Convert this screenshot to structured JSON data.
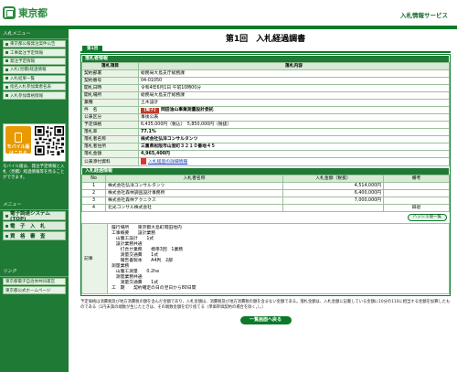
{
  "header": {
    "logo_text": "東京都",
    "service_name": "入札情報サービス"
  },
  "sidebar": {
    "menu_title": "入札メニュー",
    "items": [
      "東京都公報発注案件公告",
      "工事発注予定情報",
      "発注予定情報",
      "入札(見積)経過情報",
      "入札結果一覧",
      "指名入札参加業者名表",
      "入札参加資格情報"
    ],
    "mobile_label": "モバイル版",
    "mobile_sub": "はこちら",
    "mobile_desc": "モバイル版は、発注予定情報と入札（見積）経過情報等を見ることができます。",
    "sys_title": "メニュー",
    "sys_items": [
      "電子調達システム(TOP)",
      "電　子　入　札",
      "資　格　審　査"
    ],
    "links_title": "リンク",
    "links": [
      "東京都電子自治体共同運営",
      "東京都公式ホームページ"
    ]
  },
  "page": {
    "title": "第1回　入札経過調書",
    "tab": "第1回",
    "sec_info": "落札者情報",
    "col_item": "落札項目",
    "col_content": "落札内容",
    "rows": [
      {
        "label": "契約部署",
        "value": "総務局大島支庁総務課"
      },
      {
        "label": "契約番号",
        "value": "04-01050"
      },
      {
        "label": "開札日時",
        "value": "令和4年6月1日 午前10時00分"
      },
      {
        "label": "開札場所",
        "value": "総務局大島支庁総務課"
      },
      {
        "label": "業種",
        "value": "土木設計"
      },
      {
        "label": "件　名",
        "value": "岡田油山事業測量設計委託",
        "badge": "【電子】"
      },
      {
        "label": "公表区分",
        "value": "事後公表"
      },
      {
        "label": "予定価格",
        "value": "6,435,000円（税込）　5,850,000円（税抜）"
      },
      {
        "label": "落札率",
        "value": "77.1%"
      },
      {
        "label": "落札者名称",
        "value": "株式会社弘洋コンサルタンツ"
      },
      {
        "label": "落札者住所",
        "value": "三重県松阪市山室町３２１０番地４５"
      },
      {
        "label": "落札金額",
        "value": "4,965,400円"
      }
    ],
    "pdf_label": "公表添付資料",
    "pdf_link": "入札経過の詳細情報",
    "sec_history": "入札経過情報",
    "hist_headers": [
      "No",
      "入札者名称",
      "入札金額（税抜）",
      "備考"
    ],
    "hist_rows": [
      {
        "no": "1",
        "name": "株式会社弘洋コンサルタンツ",
        "amount": "4,514,000円",
        "note": ""
      },
      {
        "no": "2",
        "name": "株式会社森林調査設計事務所",
        "amount": "6,400,000円",
        "note": ""
      },
      {
        "no": "3",
        "name": "株式会社森林テクニクス",
        "amount": "7,000,000円",
        "note": ""
      },
      {
        "no": "4",
        "name": "北光コンサル株式会社",
        "amount": "",
        "note": "辞退"
      }
    ],
    "hash_btn": "ハッシュ値一覧",
    "notes_label": "記事",
    "notes": [
      "履行場所　　東京都大島町岡田地内",
      "工事概要　　設計業務",
      "　山腹工設計　　1式",
      "　設計業務共通",
      "　　打合せ業務　　標準3回　1業務",
      "　　測量交通費　　1式",
      "　　報告書製本　　A4判　2部",
      "測量業務",
      "　山腹工測量　　0.2ha",
      "　測量業務共通",
      "　　測量交通費　　1式",
      "工　期　　契約確定の日の翌日から80日間"
    ],
    "footer": "予定価格は消費税及び地方消費税の額を含んだ金額であり、入札金額は、消費税及び地方消費税の額を含まない金額である。落札金額は、入札金額に記載している金額に10分の110に相当する金額を加算したものである（1円未満の端数が生じたときは、その端数金額を切り捨てる（単価単価契約の場合を除く。）。）",
    "back_btn": "一覧画面へ戻る"
  },
  "colors": {
    "brand_green": "#0b7a2a",
    "sidebar_green": "#1e7a34",
    "mobile_orange": "#e89a00"
  }
}
